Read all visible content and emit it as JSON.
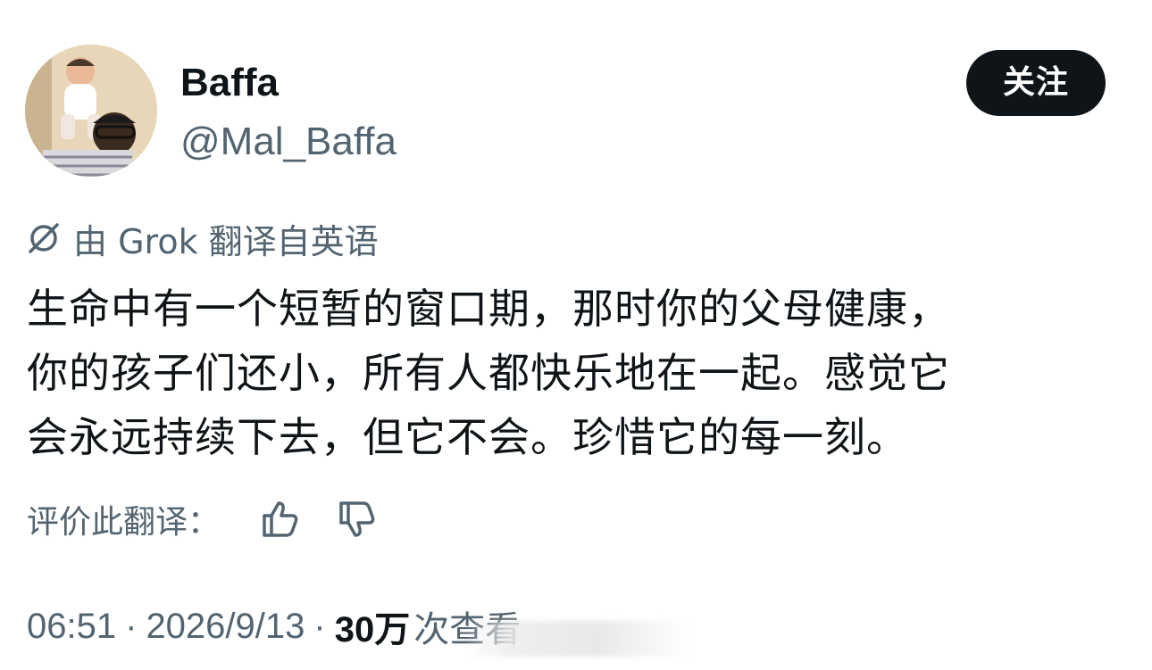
{
  "author": {
    "display_name": "Baffa",
    "handle": "@Mal_Baffa",
    "avatar_icon": "avatar-photo"
  },
  "follow_button": {
    "label": "关注"
  },
  "translation": {
    "notice": "由 Grok 翻译自英语",
    "icon": "grok-icon"
  },
  "tweet": {
    "text": "生命中有一个短暂的窗口期，那时你的父母健康，\n你的孩子们还小，所有人都快乐地在一起。感觉它\n会永远持续下去，但它不会。珍惜它的每一刻。"
  },
  "rate_translation": {
    "label": "评价此翻译：",
    "up_icon": "thumbs-up-icon",
    "down_icon": "thumbs-down-icon"
  },
  "meta": {
    "time": "06:51",
    "separator": "·",
    "date": "2026/9/13",
    "views_count": "30万",
    "views_label": "次查看"
  },
  "colors": {
    "text_primary": "#0f1419",
    "text_secondary": "#536471",
    "button_bg": "#0f1419",
    "button_text": "#ffffff",
    "background": "#ffffff"
  }
}
